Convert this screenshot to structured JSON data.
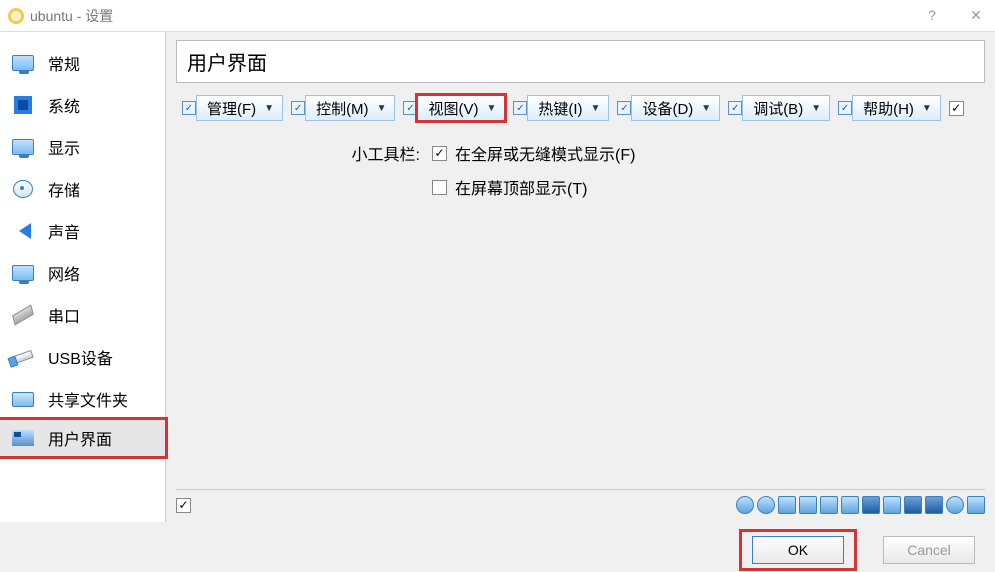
{
  "window": {
    "title": "ubuntu - 设置"
  },
  "sidebar": {
    "items": [
      {
        "label": "常规"
      },
      {
        "label": "系统"
      },
      {
        "label": "显示"
      },
      {
        "label": "存储"
      },
      {
        "label": "声音"
      },
      {
        "label": "网络"
      },
      {
        "label": "串口"
      },
      {
        "label": "USB设备"
      },
      {
        "label": "共享文件夹"
      },
      {
        "label": "用户界面"
      }
    ]
  },
  "page": {
    "title": "用户界面"
  },
  "toolbar": {
    "items": [
      {
        "label": "管理(F)"
      },
      {
        "label": "控制(M)"
      },
      {
        "label": "视图(V)"
      },
      {
        "label": "热键(I)"
      },
      {
        "label": "设备(D)"
      },
      {
        "label": "调试(B)"
      },
      {
        "label": "帮助(H)"
      }
    ],
    "end_checked": "✓"
  },
  "options": {
    "group_label": "小工具栏:",
    "opt1_checked": "✓",
    "opt1_label": "在全屏或无缝模式显示(F)",
    "opt2_checked": "",
    "opt2_label": "在屏幕顶部显示(T)"
  },
  "bottom": {
    "left_checked": "✓"
  },
  "footer": {
    "ok": "OK",
    "cancel": "Cancel"
  },
  "colors": {
    "highlight": "#d43434"
  }
}
